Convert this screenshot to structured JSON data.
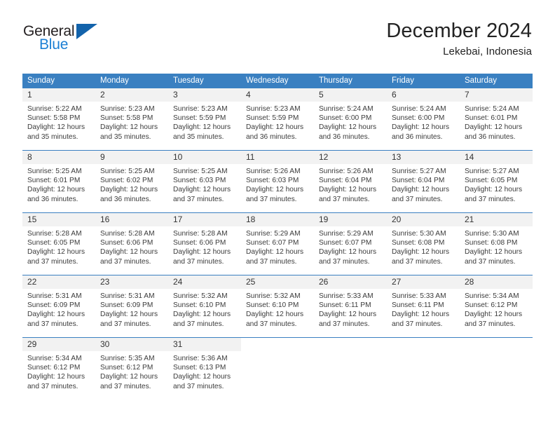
{
  "logo": {
    "line1": "General",
    "line2": "Blue",
    "mark": "triangle-logo-icon"
  },
  "header": {
    "title": "December 2024",
    "subtitle": "Lekebai, Indonesia"
  },
  "colors": {
    "header_blue": "#3a80c1",
    "logo_blue": "#1b7fd4",
    "logo_triangle": "#1363ab",
    "daynum_band": "#f2f2f2",
    "text": "#3b3b3b"
  },
  "weekdays": [
    "Sunday",
    "Monday",
    "Tuesday",
    "Wednesday",
    "Thursday",
    "Friday",
    "Saturday"
  ],
  "weeks": [
    [
      {
        "day": "1",
        "sunrise": "Sunrise: 5:22 AM",
        "sunset": "Sunset: 5:58 PM",
        "daylight1": "Daylight: 12 hours",
        "daylight2": "and 35 minutes."
      },
      {
        "day": "2",
        "sunrise": "Sunrise: 5:23 AM",
        "sunset": "Sunset: 5:58 PM",
        "daylight1": "Daylight: 12 hours",
        "daylight2": "and 35 minutes."
      },
      {
        "day": "3",
        "sunrise": "Sunrise: 5:23 AM",
        "sunset": "Sunset: 5:59 PM",
        "daylight1": "Daylight: 12 hours",
        "daylight2": "and 35 minutes."
      },
      {
        "day": "4",
        "sunrise": "Sunrise: 5:23 AM",
        "sunset": "Sunset: 5:59 PM",
        "daylight1": "Daylight: 12 hours",
        "daylight2": "and 36 minutes."
      },
      {
        "day": "5",
        "sunrise": "Sunrise: 5:24 AM",
        "sunset": "Sunset: 6:00 PM",
        "daylight1": "Daylight: 12 hours",
        "daylight2": "and 36 minutes."
      },
      {
        "day": "6",
        "sunrise": "Sunrise: 5:24 AM",
        "sunset": "Sunset: 6:00 PM",
        "daylight1": "Daylight: 12 hours",
        "daylight2": "and 36 minutes."
      },
      {
        "day": "7",
        "sunrise": "Sunrise: 5:24 AM",
        "sunset": "Sunset: 6:01 PM",
        "daylight1": "Daylight: 12 hours",
        "daylight2": "and 36 minutes."
      }
    ],
    [
      {
        "day": "8",
        "sunrise": "Sunrise: 5:25 AM",
        "sunset": "Sunset: 6:01 PM",
        "daylight1": "Daylight: 12 hours",
        "daylight2": "and 36 minutes."
      },
      {
        "day": "9",
        "sunrise": "Sunrise: 5:25 AM",
        "sunset": "Sunset: 6:02 PM",
        "daylight1": "Daylight: 12 hours",
        "daylight2": "and 36 minutes."
      },
      {
        "day": "10",
        "sunrise": "Sunrise: 5:25 AM",
        "sunset": "Sunset: 6:03 PM",
        "daylight1": "Daylight: 12 hours",
        "daylight2": "and 37 minutes."
      },
      {
        "day": "11",
        "sunrise": "Sunrise: 5:26 AM",
        "sunset": "Sunset: 6:03 PM",
        "daylight1": "Daylight: 12 hours",
        "daylight2": "and 37 minutes."
      },
      {
        "day": "12",
        "sunrise": "Sunrise: 5:26 AM",
        "sunset": "Sunset: 6:04 PM",
        "daylight1": "Daylight: 12 hours",
        "daylight2": "and 37 minutes."
      },
      {
        "day": "13",
        "sunrise": "Sunrise: 5:27 AM",
        "sunset": "Sunset: 6:04 PM",
        "daylight1": "Daylight: 12 hours",
        "daylight2": "and 37 minutes."
      },
      {
        "day": "14",
        "sunrise": "Sunrise: 5:27 AM",
        "sunset": "Sunset: 6:05 PM",
        "daylight1": "Daylight: 12 hours",
        "daylight2": "and 37 minutes."
      }
    ],
    [
      {
        "day": "15",
        "sunrise": "Sunrise: 5:28 AM",
        "sunset": "Sunset: 6:05 PM",
        "daylight1": "Daylight: 12 hours",
        "daylight2": "and 37 minutes."
      },
      {
        "day": "16",
        "sunrise": "Sunrise: 5:28 AM",
        "sunset": "Sunset: 6:06 PM",
        "daylight1": "Daylight: 12 hours",
        "daylight2": "and 37 minutes."
      },
      {
        "day": "17",
        "sunrise": "Sunrise: 5:28 AM",
        "sunset": "Sunset: 6:06 PM",
        "daylight1": "Daylight: 12 hours",
        "daylight2": "and 37 minutes."
      },
      {
        "day": "18",
        "sunrise": "Sunrise: 5:29 AM",
        "sunset": "Sunset: 6:07 PM",
        "daylight1": "Daylight: 12 hours",
        "daylight2": "and 37 minutes."
      },
      {
        "day": "19",
        "sunrise": "Sunrise: 5:29 AM",
        "sunset": "Sunset: 6:07 PM",
        "daylight1": "Daylight: 12 hours",
        "daylight2": "and 37 minutes."
      },
      {
        "day": "20",
        "sunrise": "Sunrise: 5:30 AM",
        "sunset": "Sunset: 6:08 PM",
        "daylight1": "Daylight: 12 hours",
        "daylight2": "and 37 minutes."
      },
      {
        "day": "21",
        "sunrise": "Sunrise: 5:30 AM",
        "sunset": "Sunset: 6:08 PM",
        "daylight1": "Daylight: 12 hours",
        "daylight2": "and 37 minutes."
      }
    ],
    [
      {
        "day": "22",
        "sunrise": "Sunrise: 5:31 AM",
        "sunset": "Sunset: 6:09 PM",
        "daylight1": "Daylight: 12 hours",
        "daylight2": "and 37 minutes."
      },
      {
        "day": "23",
        "sunrise": "Sunrise: 5:31 AM",
        "sunset": "Sunset: 6:09 PM",
        "daylight1": "Daylight: 12 hours",
        "daylight2": "and 37 minutes."
      },
      {
        "day": "24",
        "sunrise": "Sunrise: 5:32 AM",
        "sunset": "Sunset: 6:10 PM",
        "daylight1": "Daylight: 12 hours",
        "daylight2": "and 37 minutes."
      },
      {
        "day": "25",
        "sunrise": "Sunrise: 5:32 AM",
        "sunset": "Sunset: 6:10 PM",
        "daylight1": "Daylight: 12 hours",
        "daylight2": "and 37 minutes."
      },
      {
        "day": "26",
        "sunrise": "Sunrise: 5:33 AM",
        "sunset": "Sunset: 6:11 PM",
        "daylight1": "Daylight: 12 hours",
        "daylight2": "and 37 minutes."
      },
      {
        "day": "27",
        "sunrise": "Sunrise: 5:33 AM",
        "sunset": "Sunset: 6:11 PM",
        "daylight1": "Daylight: 12 hours",
        "daylight2": "and 37 minutes."
      },
      {
        "day": "28",
        "sunrise": "Sunrise: 5:34 AM",
        "sunset": "Sunset: 6:12 PM",
        "daylight1": "Daylight: 12 hours",
        "daylight2": "and 37 minutes."
      }
    ],
    [
      {
        "day": "29",
        "sunrise": "Sunrise: 5:34 AM",
        "sunset": "Sunset: 6:12 PM",
        "daylight1": "Daylight: 12 hours",
        "daylight2": "and 37 minutes."
      },
      {
        "day": "30",
        "sunrise": "Sunrise: 5:35 AM",
        "sunset": "Sunset: 6:12 PM",
        "daylight1": "Daylight: 12 hours",
        "daylight2": "and 37 minutes."
      },
      {
        "day": "31",
        "sunrise": "Sunrise: 5:36 AM",
        "sunset": "Sunset: 6:13 PM",
        "daylight1": "Daylight: 12 hours",
        "daylight2": "and 37 minutes."
      },
      {
        "day": "",
        "sunrise": "",
        "sunset": "",
        "daylight1": "",
        "daylight2": ""
      },
      {
        "day": "",
        "sunrise": "",
        "sunset": "",
        "daylight1": "",
        "daylight2": ""
      },
      {
        "day": "",
        "sunrise": "",
        "sunset": "",
        "daylight1": "",
        "daylight2": ""
      },
      {
        "day": "",
        "sunrise": "",
        "sunset": "",
        "daylight1": "",
        "daylight2": ""
      }
    ]
  ]
}
